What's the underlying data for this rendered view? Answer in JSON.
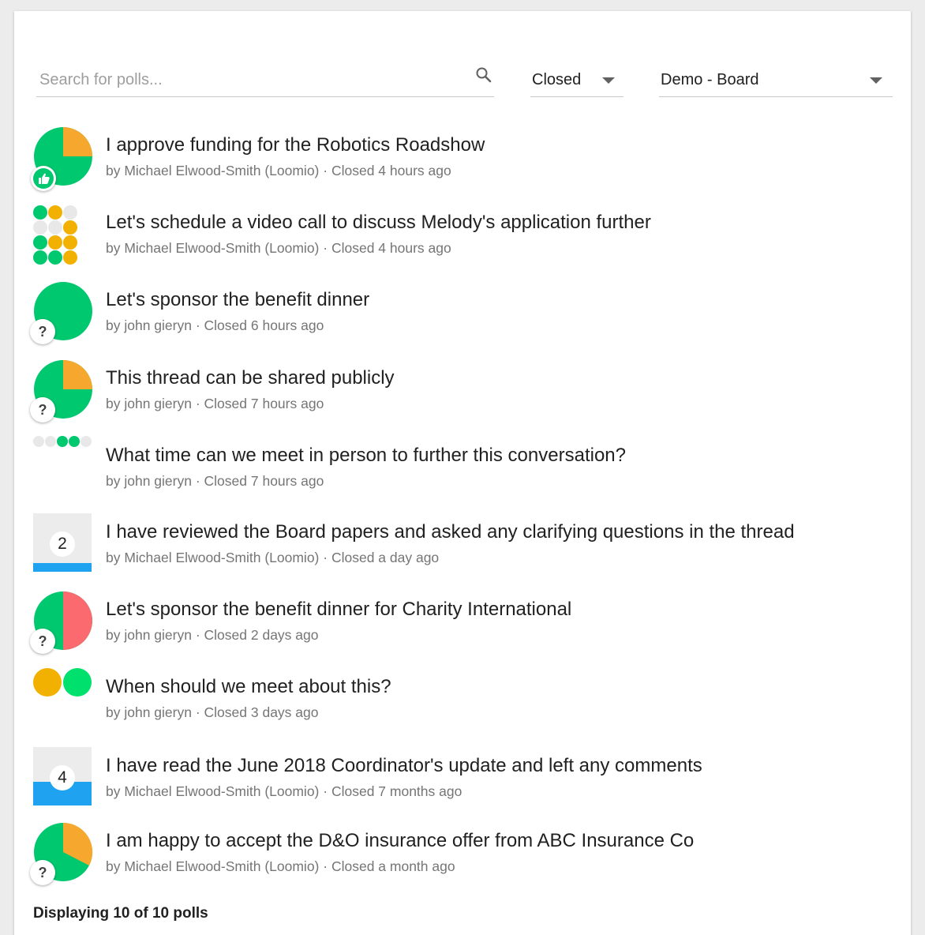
{
  "search": {
    "placeholder": "Search for polls...",
    "value": "",
    "icon": "magnify-icon"
  },
  "filters": {
    "status": {
      "selected": "Closed"
    },
    "group": {
      "selected": "Demo - Board"
    }
  },
  "polls": [
    {
      "title": "I approve funding for the Robotics Roadshow",
      "author": "by Michael Elwood-Smith (Loomio)",
      "closed": "Closed 4 hours ago",
      "chart": "pie",
      "agree_fraction": 0.75,
      "badge": "thumbs-up-icon"
    },
    {
      "title": "Let's schedule a video call to discuss Melody's application further",
      "author": "by Michael Elwood-Smith (Loomio)",
      "closed": "Closed 4 hours ago",
      "chart": "dot-matrix",
      "badge": "none"
    },
    {
      "title": "Let's sponsor the benefit dinner",
      "author": "by john gieryn",
      "closed": "Closed 6 hours ago",
      "chart": "pie",
      "agree_fraction": 1.0,
      "badge": "?"
    },
    {
      "title": "This thread can be shared publicly",
      "author": "by john gieryn",
      "closed": "Closed 7 hours ago",
      "chart": "pie",
      "agree_fraction": 0.75,
      "badge": "?"
    },
    {
      "title": "What time can we meet in person to further this conversation?",
      "author": "by john gieryn",
      "closed": "Closed 7 hours ago",
      "chart": "dot-row",
      "badge": "none"
    },
    {
      "title": "I have reviewed the Board papers and asked any clarifying questions in the thread",
      "author": "by Michael Elwood-Smith (Loomio)",
      "closed": "Closed a day ago",
      "chart": "count",
      "count": "2",
      "fill_fraction": 0.15,
      "badge": "none"
    },
    {
      "title": "Let's sponsor the benefit dinner for Charity International",
      "author": "by john gieryn",
      "closed": "Closed 2 days ago",
      "chart": "pie",
      "agree_fraction": 0.5,
      "disagree": true,
      "badge": "?"
    },
    {
      "title": "When should we meet about this?",
      "author": "by john gieryn",
      "closed": "Closed 3 days ago",
      "chart": "two-dots",
      "badge": "none"
    },
    {
      "title": "I have read the June 2018 Coordinator's update and left any comments",
      "author": "by Michael Elwood-Smith (Loomio)",
      "closed": "Closed 7 months ago",
      "chart": "count",
      "count": "4",
      "fill_fraction": 0.4,
      "badge": "none"
    },
    {
      "title": "I am happy to accept the D&O insurance offer from ABC Insurance Co",
      "author": "by Michael Elwood-Smith (Loomio)",
      "closed": "Closed a month ago",
      "chart": "pie",
      "agree_fraction": 0.62,
      "badge": "?"
    }
  ],
  "colors": {
    "agree": "#00c86f",
    "abstain": "#f6a82e",
    "disagree": "#fa6a6e",
    "dot_yellow": "#f2b100",
    "dot_grey": "#e8e8e8",
    "count_bar": "#1fa3f0"
  },
  "footer": {
    "summary": "Displaying 10 of 10 polls"
  }
}
